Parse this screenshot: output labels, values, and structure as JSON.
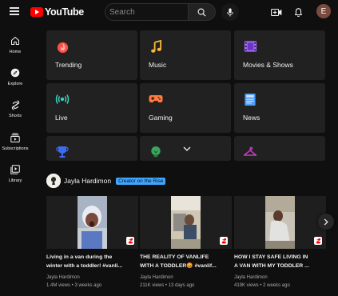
{
  "header": {
    "logo_text": "YouTube",
    "search_placeholder": "Search",
    "avatar_letter": "E"
  },
  "sidebar": {
    "items": [
      {
        "label": "Home",
        "icon": "home-icon"
      },
      {
        "label": "Explore",
        "icon": "compass-icon"
      },
      {
        "label": "Shorts",
        "icon": "shorts-icon"
      },
      {
        "label": "Subscriptions",
        "icon": "subscriptions-icon"
      },
      {
        "label": "Library",
        "icon": "library-icon"
      }
    ]
  },
  "categories": [
    {
      "label": "Trending",
      "icon": "flame-icon",
      "color": "#ff4e45"
    },
    {
      "label": "Music",
      "icon": "music-note-icon",
      "color": "#f6b73c"
    },
    {
      "label": "Movies & Shows",
      "icon": "film-strip-icon",
      "color": "#a76cf7"
    },
    {
      "label": "Live",
      "icon": "live-broadcast-icon",
      "color": "#34d3c0"
    },
    {
      "label": "Gaming",
      "icon": "game-controller-icon",
      "color": "#ff7a3d"
    },
    {
      "label": "News",
      "icon": "newspaper-icon",
      "color": "#4f9cf9"
    },
    {
      "label": "",
      "icon": "trophy-icon",
      "color": "#3d6cf0"
    },
    {
      "label": "",
      "icon": "lightbulb-icon",
      "color": "#3ba55d"
    },
    {
      "label": "",
      "icon": "hanger-icon",
      "color": "#c33cc3"
    }
  ],
  "creator": {
    "name": "Jayla Hardimon",
    "badge": "Creator on the Rise",
    "badge_color": "#3ea6ff"
  },
  "videos": [
    {
      "title": "Living in a van during the\nwinter with a toddler! #vanli...",
      "channel": "Jayla Hardimon",
      "meta": "1.4M views • 3 weeks ago"
    },
    {
      "title": "THE REALITY OF VANLIFE\nWITH A TODDLER😡 #vanlif...",
      "channel": "Jayla Hardimon",
      "meta": "211K views • 13 days ago"
    },
    {
      "title": "HOW I STAY SAFE LIVING IN\nA VAN WITH MY TODDLER ...",
      "channel": "Jayla Hardimon",
      "meta": "419K views • 2 weeks ago"
    }
  ],
  "colors": {
    "brand_red": "#ff0000",
    "background": "#0f0f0f",
    "tile": "#212121"
  }
}
